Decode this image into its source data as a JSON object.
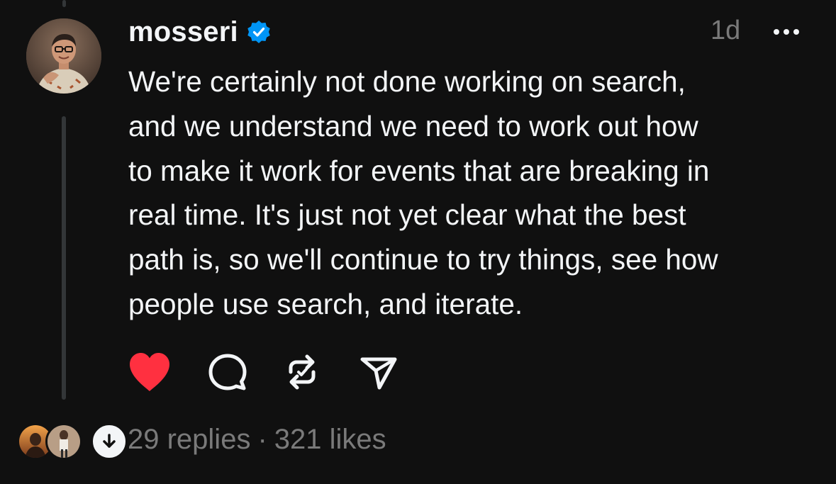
{
  "post": {
    "username": "mosseri",
    "verified": true,
    "timestamp": "1d",
    "text": "We're certainly not done working on search,\nand we understand we need to work out how\nto make it work for events that are breaking in\nreal time. It's just not yet clear what the best\npath is, so we'll continue to try things, see how\npeople use search, and iterate.",
    "liked": true
  },
  "actions": [
    {
      "icon": "heart-filled-icon"
    },
    {
      "icon": "comment-icon"
    },
    {
      "icon": "repost-icon"
    },
    {
      "icon": "share-send-icon"
    }
  ],
  "footer": {
    "replies": "29 replies",
    "separator": "·",
    "likes": "321 likes"
  },
  "colors": {
    "background": "#101010",
    "text": "#f3f5f7",
    "secondary": "#7a7a7a",
    "like": "#ff3040",
    "verified": "#0095f6",
    "thread_line": "#333638"
  }
}
